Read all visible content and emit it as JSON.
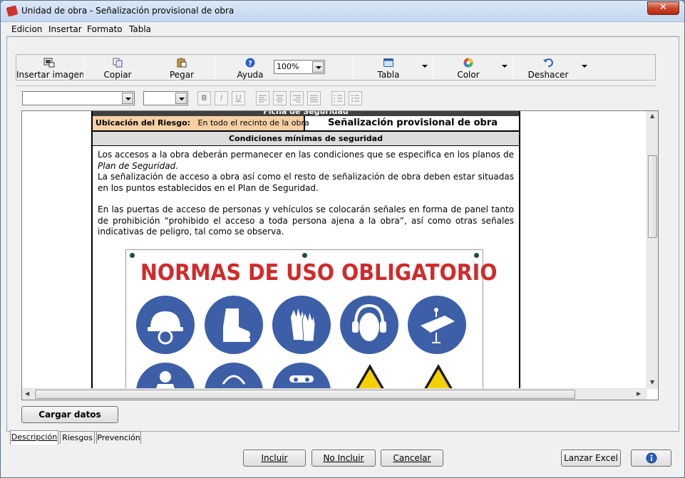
{
  "window": {
    "title": "Unidad de obra - Señalización provisional de obra",
    "close_label": "✕"
  },
  "menu": [
    "Edicion",
    "Insertar",
    "Formato",
    "Tabla"
  ],
  "toolbar": {
    "insert_image": "Insertar imagen",
    "copy": "Copiar",
    "paste": "Pegar",
    "help": "Ayuda",
    "zoom": "100%",
    "table": "Tabla",
    "color": "Color",
    "undo": "Deshacer"
  },
  "format": {
    "bold": "B",
    "italic": "I",
    "underline": "U"
  },
  "document": {
    "header": "Ficha de Seguridad",
    "location_label": "Ubicación del Riesgo:",
    "location_value": "En todo el recinto de la obra",
    "unit_title": "Señalización provisional de obra",
    "section_title": "Condiciones mínimas de seguridad",
    "para1a": "Los accesos a la obra deberán permanecer en las condiciones que se especifica en los planos de ",
    "para1b": "Plan de Seguridad",
    "para1c": ".",
    "para2": "La señalización de acceso a obra así como el resto de señalización de obra deben estar situadas en los puntos establecidos en el Plan de Seguridad.",
    "para3": "En las puertas de acceso de personas y vehículos se colocarán señales en forma de panel tanto de prohibición “prohibido el acceso a toda persona ajena a la obra”, así como otras señales indicativas de peligro, tal como se observa.",
    "sign_title": "NORMAS DE USO OBLIGATORIO"
  },
  "buttons": {
    "load_data": "Cargar datos",
    "include": "Incluir",
    "not_include": "No Incluir",
    "cancel": "Cancelar",
    "launch_excel": "Lanzar Excel"
  },
  "tabs": [
    "Descripción",
    "Riesgos",
    "Prevención"
  ],
  "colors": {
    "sign_blue": "#3d5fa8",
    "sign_red": "#d12a2a",
    "ubic_bg": "#f7cfa5"
  }
}
